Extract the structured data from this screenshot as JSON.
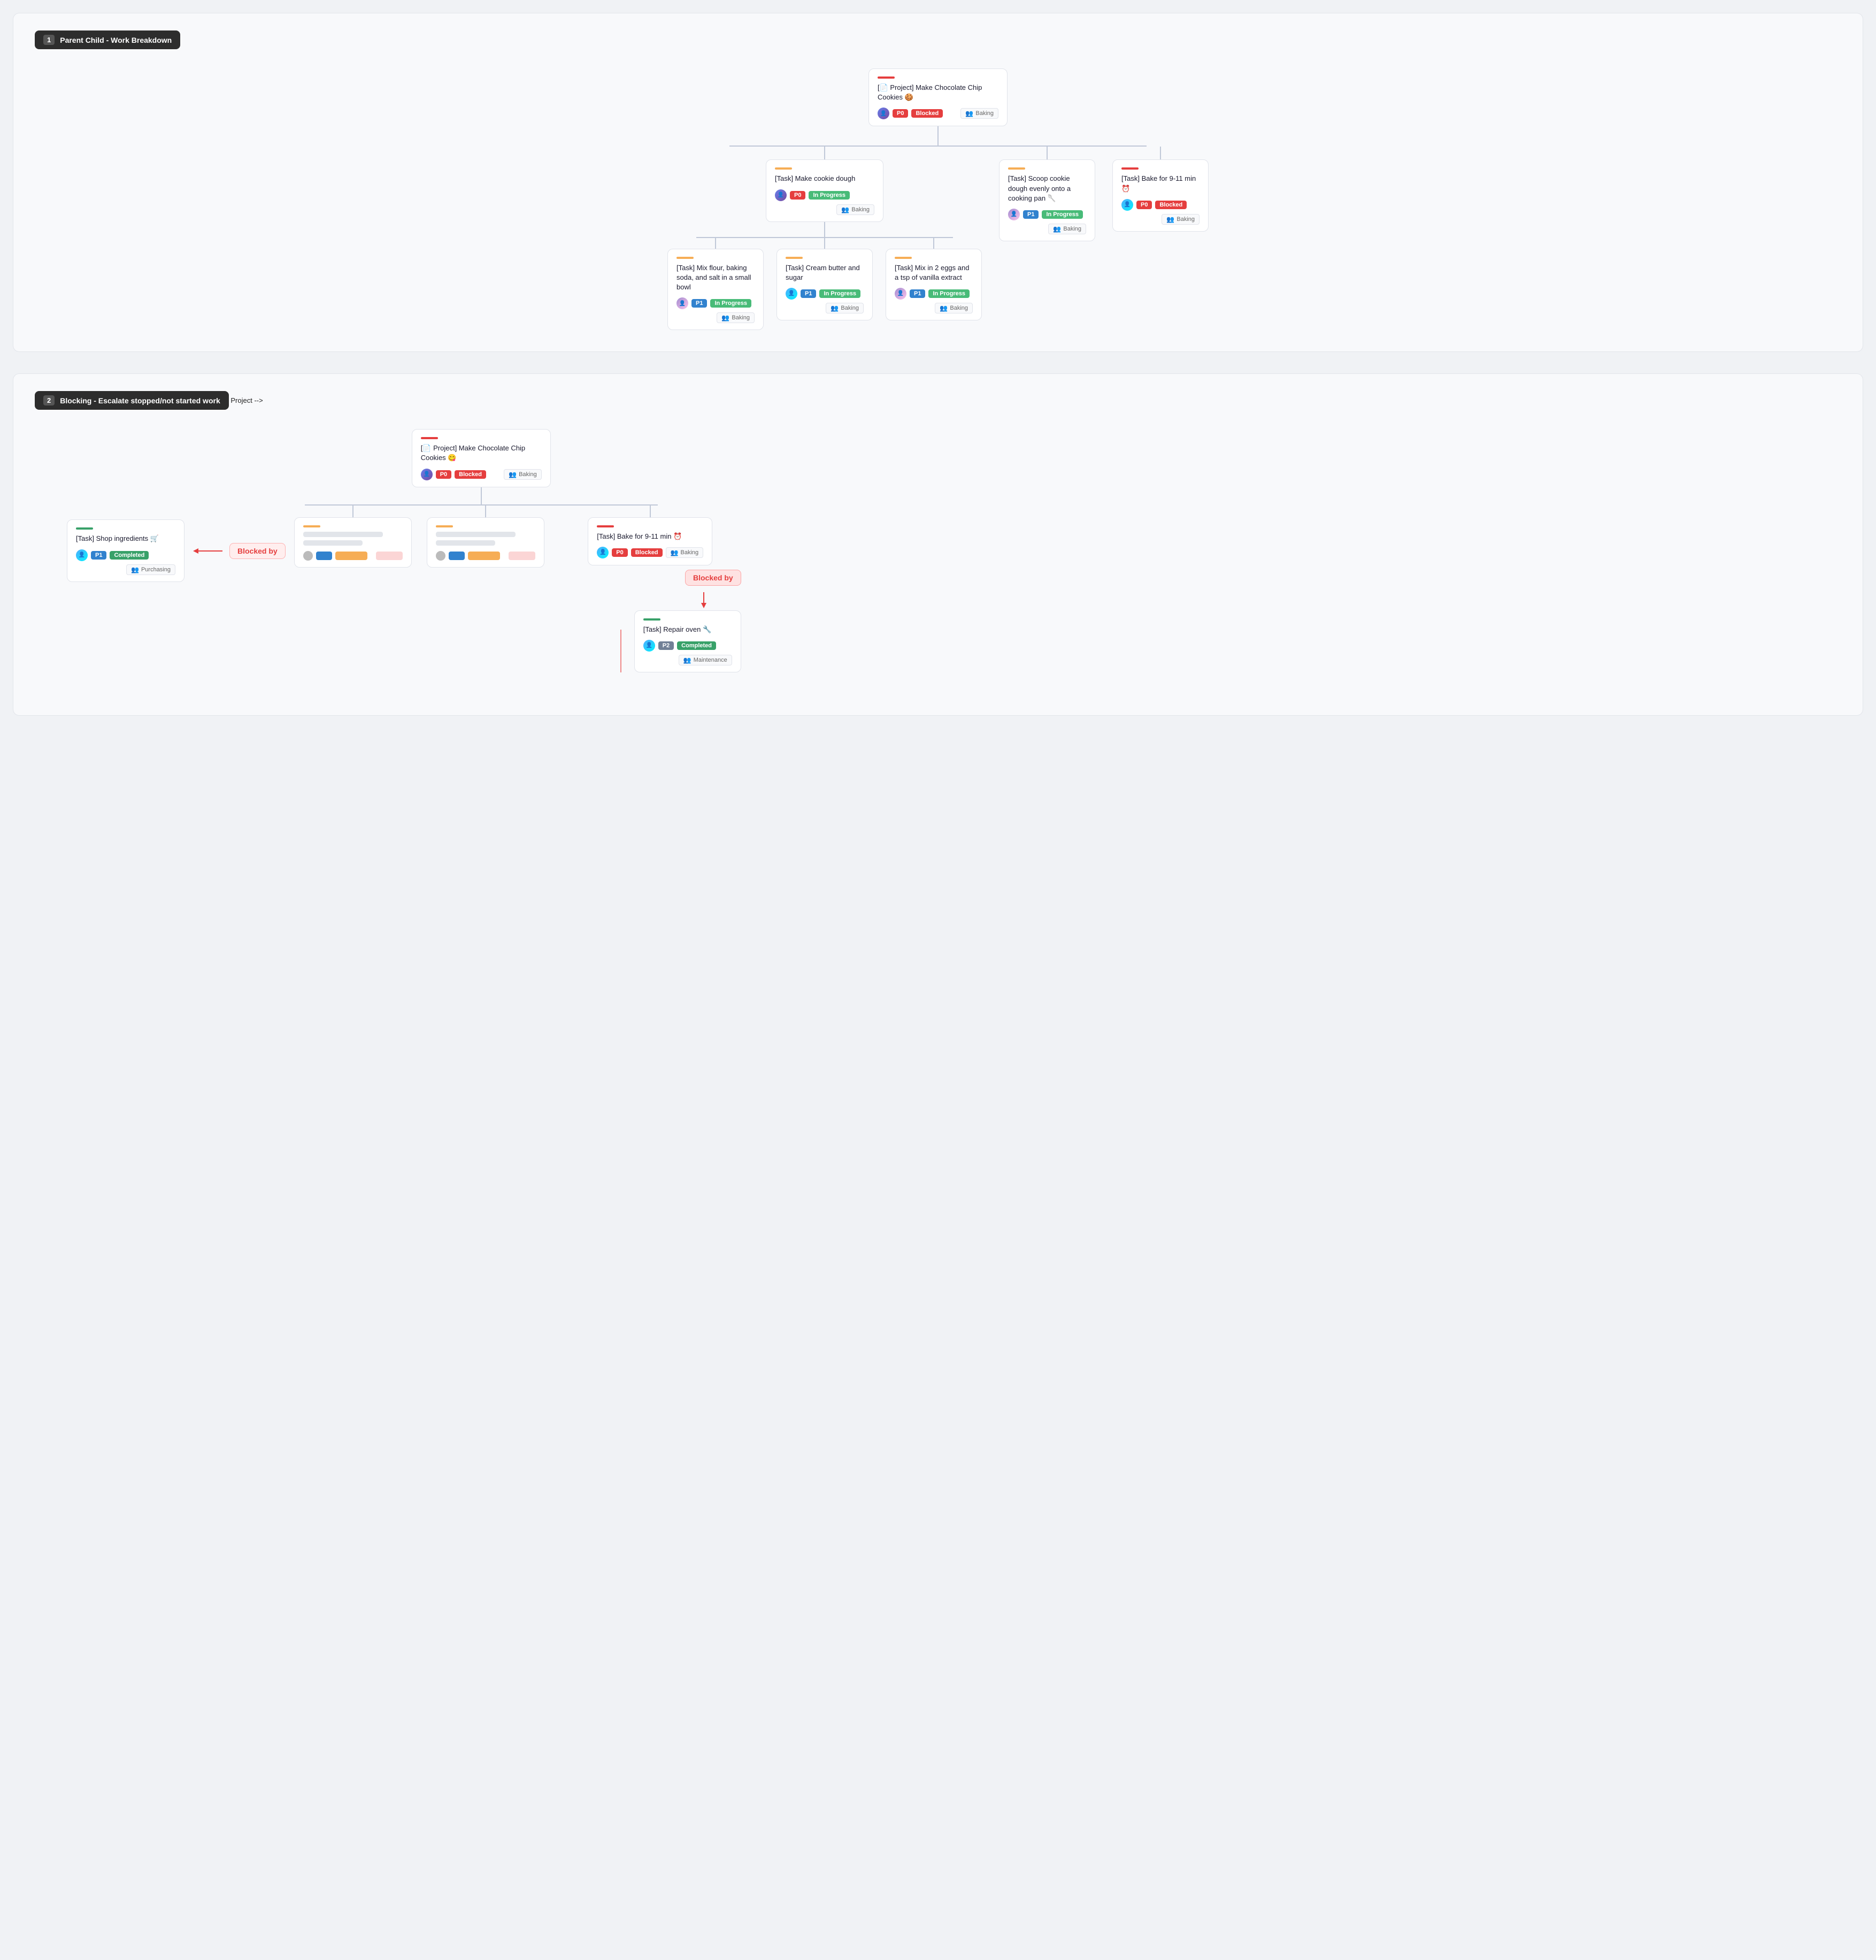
{
  "section1": {
    "number": "1",
    "title": "Parent Child - Work Breakdown",
    "root": {
      "accent": "accent-red",
      "title": "[📄 Project] Make Chocolate Chip Cookies 🍪",
      "avatar_class": "avatar",
      "badge_priority": "P0",
      "badge_priority_class": "badge-p0",
      "badge_status": "Blocked",
      "badge_status_class": "badge-blocked",
      "tag": "Baking"
    },
    "level1": [
      {
        "accent": "accent-orange",
        "title": "[Task] Make cookie dough",
        "badge_priority": "P0",
        "badge_priority_class": "badge-p0",
        "badge_status": "In Progress",
        "badge_status_class": "badge-inprogress",
        "tag": "Baking",
        "children": [
          {
            "accent": "accent-orange",
            "title": "[Task] Mix flour, baking soda, and salt in a small bowl",
            "badge_priority": "P1",
            "badge_priority_class": "badge-p1",
            "badge_status": "In Progress",
            "badge_status_class": "badge-inprogress",
            "tag": "Baking"
          },
          {
            "accent": "accent-orange",
            "title": "[Task] Cream butter and sugar",
            "badge_priority": "P1",
            "badge_priority_class": "badge-p1",
            "badge_status": "In Progress",
            "badge_status_class": "badge-inprogress",
            "tag": "Baking"
          },
          {
            "accent": "accent-orange",
            "title": "[Task] Mix in 2 eggs and a tsp of vanilla extract",
            "badge_priority": "P1",
            "badge_priority_class": "badge-p1",
            "badge_status": "In Progress",
            "badge_status_class": "badge-inprogress",
            "tag": "Baking"
          }
        ]
      },
      {
        "accent": "accent-orange",
        "title": "[Task] Scoop cookie dough evenly onto a cooking pan 🥄",
        "badge_priority": "P1",
        "badge_priority_class": "badge-p1",
        "badge_status": "In Progress",
        "badge_status_class": "badge-inprogress",
        "tag": "Baking",
        "children": []
      },
      {
        "accent": "accent-red",
        "title": "[Task] Bake for 9-11 min ⏰",
        "badge_priority": "P0",
        "badge_priority_class": "badge-p0",
        "badge_status": "Blocked",
        "badge_status_class": "badge-blocked",
        "tag": "Baking",
        "children": []
      }
    ]
  },
  "section2": {
    "number": "2",
    "title": "Blocking - Escalate stopped/not started work",
    "shop": {
      "accent": "accent-green",
      "title": "[Task] Shop ingredients 🛒",
      "badge_priority": "P1",
      "badge_priority_class": "badge-p1",
      "badge_status": "Completed",
      "badge_status_class": "badge-completed",
      "tag": "Purchasing"
    },
    "blocked_by_label1": "Blocked by",
    "project": {
      "accent": "accent-red",
      "title": "[📄 Project] Make Chocolate Chip Cookies 😋",
      "badge_priority": "P0",
      "badge_priority_class": "badge-p0",
      "badge_status": "Blocked",
      "badge_status_class": "badge-blocked",
      "tag": "Baking"
    },
    "bake": {
      "accent": "accent-red",
      "title": "[Task] Bake for 9-11 min ⏰",
      "badge_priority": "P0",
      "badge_priority_class": "badge-p0",
      "badge_status": "Blocked",
      "badge_status_class": "badge-blocked",
      "tag": "Baking"
    },
    "blocked_by_label2": "Blocked by",
    "repair": {
      "accent": "accent-green",
      "title": "[Task] Repair oven 🔧",
      "badge_priority": "P2",
      "badge_priority_class": "badge-p2",
      "badge_status": "Completed",
      "badge_status_class": "badge-completed",
      "tag": "Maintenance"
    }
  }
}
